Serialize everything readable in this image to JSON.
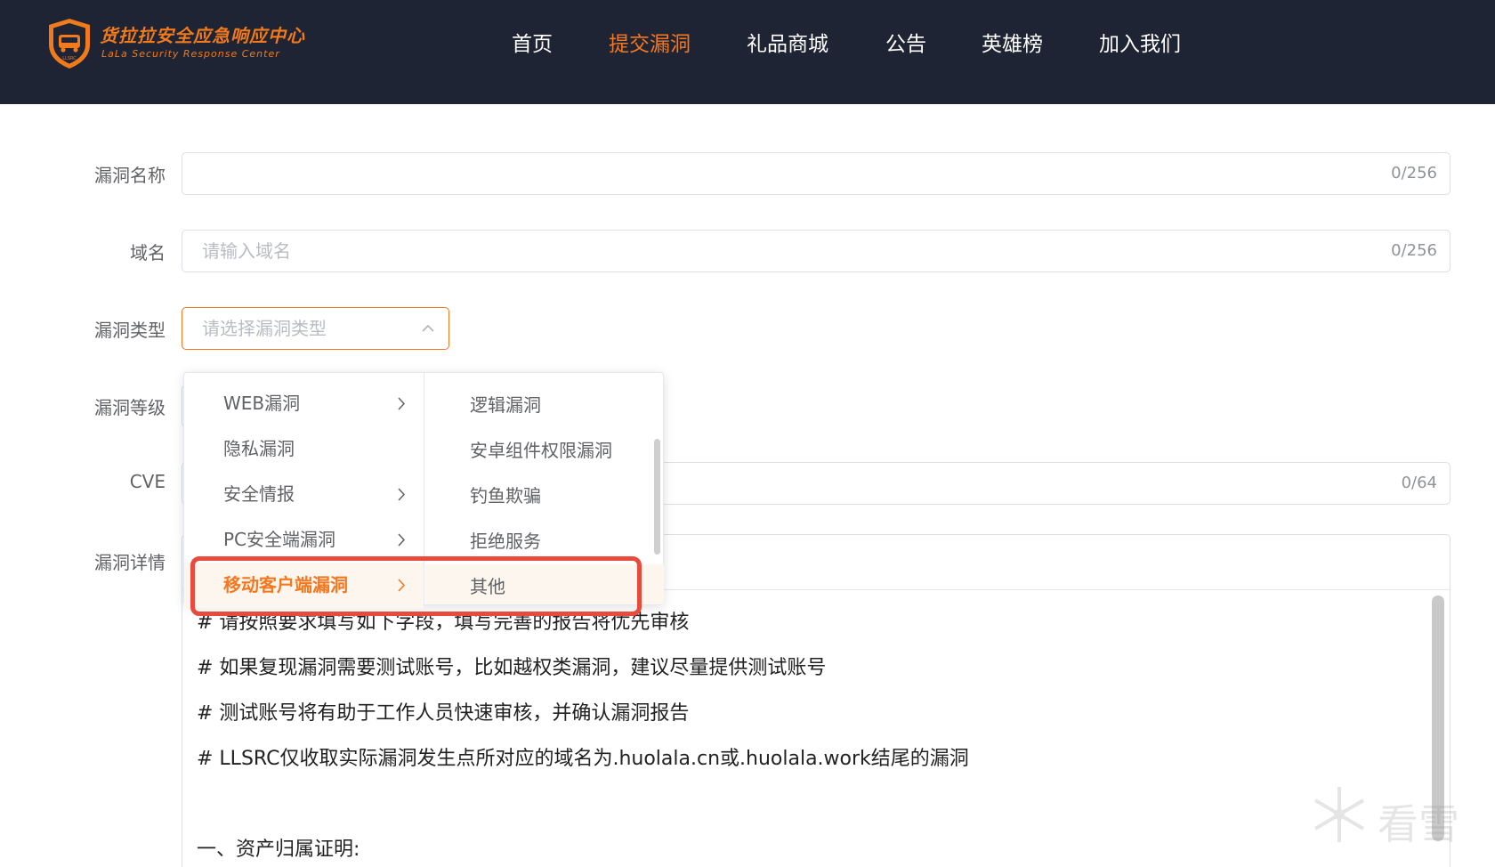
{
  "brand": {
    "title": "货拉拉安全应急响应中心",
    "subtitle": "LaLa Security Response Center",
    "badge": "LLSRC"
  },
  "nav": [
    {
      "label": "首页",
      "active": false
    },
    {
      "label": "提交漏洞",
      "active": true
    },
    {
      "label": "礼品商城",
      "active": false
    },
    {
      "label": "公告",
      "active": false
    },
    {
      "label": "英雄榜",
      "active": false
    },
    {
      "label": "加入我们",
      "active": false
    }
  ],
  "form": {
    "name": {
      "label": "漏洞名称",
      "value": "",
      "placeholder": "",
      "counter": "0/256"
    },
    "domain": {
      "label": "域名",
      "value": "",
      "placeholder": "请输入域名",
      "counter": "0/256"
    },
    "type": {
      "label": "漏洞类型",
      "placeholder": "请选择漏洞类型"
    },
    "level": {
      "label": "漏洞等级"
    },
    "cve": {
      "label": "CVE",
      "counter": "0/64"
    },
    "detail": {
      "label": "漏洞详情"
    }
  },
  "cascader": {
    "level1": [
      {
        "label": "WEB漏洞",
        "has_children": true
      },
      {
        "label": "隐私漏洞",
        "has_children": false
      },
      {
        "label": "安全情报",
        "has_children": true
      },
      {
        "label": "PC安全端漏洞",
        "has_children": true
      },
      {
        "label": "移动客户端漏洞",
        "has_children": true,
        "active": true
      }
    ],
    "level2": [
      {
        "label": "逻辑漏洞"
      },
      {
        "label": "安卓组件权限漏洞"
      },
      {
        "label": "钓鱼欺骗"
      },
      {
        "label": "拒绝服务"
      },
      {
        "label": "其他"
      }
    ]
  },
  "editor": {
    "lines": [
      "# 请按照要求填写如下字段，填写完善的报告将优先审核",
      "# 如果复现漏洞需要测试账号，比如越权类漏洞，建议尽量提供测试账号",
      "# 测试账号将有助于工作人员快速审核，并确认漏洞报告",
      "# LLSRC仅收取实际漏洞发生点所对应的域名为.huolala.cn或.huolala.work结尾的漏洞",
      "一、资产归属证明:"
    ]
  },
  "watermark": {
    "text": "看雪"
  },
  "colors": {
    "header_bg": "#1e2433",
    "accent": "#f5771f",
    "highlight": "#e84b3c"
  }
}
